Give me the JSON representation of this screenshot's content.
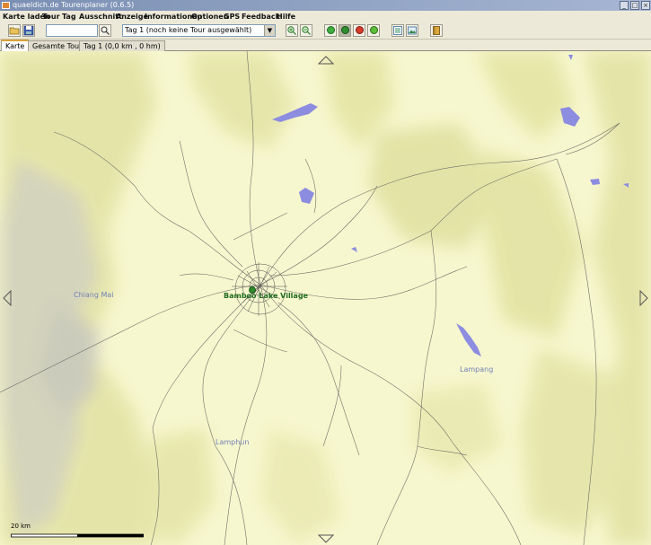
{
  "window": {
    "title": "quaeldich.de Tourenplaner (0.6.5)",
    "buttons": [
      "_",
      "□",
      "×"
    ]
  },
  "menu": [
    {
      "label": "Karte laden"
    },
    {
      "label": "Tour"
    },
    {
      "label": "Tag"
    },
    {
      "label": "Ausschnitt"
    },
    {
      "label": "Anzeige"
    },
    {
      "label": "Informationen"
    },
    {
      "label": "Optionen"
    },
    {
      "label": "GPS"
    },
    {
      "label": "Feedback"
    },
    {
      "label": "Hilfe"
    }
  ],
  "toolbar": {
    "search_value": "",
    "day_select": "Tag 1 (noch keine Tour ausgewählt)",
    "icons": [
      "open-folder-icon",
      "save-icon",
      "search-map-icon",
      "zoom-in-icon",
      "zoom-out-icon",
      "go-icon",
      "cursor-icon",
      "delete-icon",
      "add-icon",
      "list-icon",
      "image-icon",
      "book-icon"
    ]
  },
  "tabs": [
    {
      "label": "Karte",
      "active": true
    },
    {
      "label": "Gesamte Tour",
      "active": false
    },
    {
      "label": "Tag 1 (0,0 km , 0 hm)",
      "active": false
    }
  ],
  "map": {
    "places": [
      {
        "name": "Chiang Mai"
      },
      {
        "name": "Lampang"
      },
      {
        "name": "Lamphun"
      }
    ],
    "poi": {
      "name": "Bamboo Lake Village"
    },
    "scale_label": "20 km",
    "colors": {
      "lowland": "#f7f7cf",
      "hill": "#e6e6a8",
      "mountain": "#d3d3bc",
      "water": "#8c8ce0",
      "road": "#585858",
      "place_label": "#7382b6"
    }
  }
}
